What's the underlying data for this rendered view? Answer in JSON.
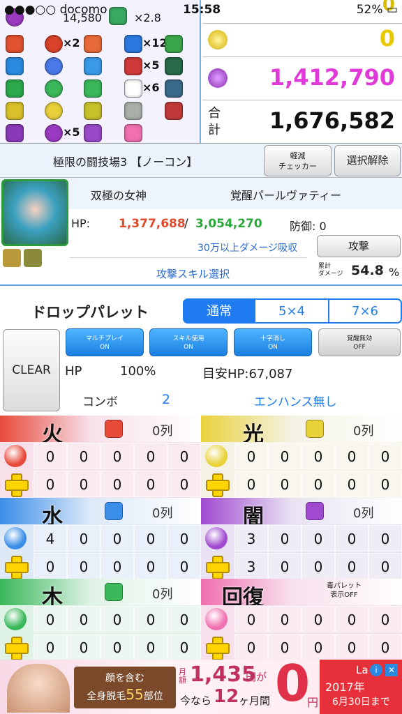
{
  "status_bar": {
    "carrier": "●●●○○ docomo",
    "time": "15:58",
    "battery": "52%"
  },
  "skill_panel": {
    "score": "14,580",
    "multiplier": "×2.8",
    "counts": [
      "×2",
      "×12",
      "×5",
      "×6",
      "×5"
    ]
  },
  "damage_panel": {
    "light_value": "0",
    "dark_value": "1,412,790",
    "total_label_1": "合",
    "total_label_2": "計",
    "total_value": "1,676,582",
    "top_value": "0"
  },
  "quest": {
    "name": "極限の闘技場3 【ノーコン】",
    "reduce_btn_1": "軽減",
    "reduce_btn_2": "チェッカー",
    "deselect_btn": "選択解除"
  },
  "monster": {
    "name_left": "双極の女神",
    "name_right": "覚醒パールヴァティー",
    "hp_label": "HP:",
    "hp_current": "1,377,688",
    "hp_sep": "/",
    "hp_max": "3,054,270",
    "defense": "防御: 0",
    "absorb": "30万以上ダメージ吸収",
    "attack_btn": "攻撃",
    "skill_select": "攻撃スキル選択",
    "cumulative_1": "累計",
    "cumulative_2": "ダメージ",
    "cumulative_value": "54.8",
    "cumulative_unit": "%"
  },
  "palette": {
    "title": "ドロップパレット",
    "tabs": [
      "通常",
      "5×4",
      "7×6"
    ],
    "active_tab": "通常",
    "clear": "CLEAR",
    "toggles": [
      {
        "label": "マルチプレイ",
        "state": "ON"
      },
      {
        "label": "スキル使用",
        "state": "ON"
      },
      {
        "label": "十字消し",
        "state": "ON"
      },
      {
        "label": "覚醒無効",
        "state": "OFF"
      }
    ],
    "hp_label": "HP",
    "hp_value": "100%",
    "target_hp": "目安HP:67,087",
    "combo_label": "コンボ",
    "combo_value": "2",
    "enhance": "エンハンス無し"
  },
  "attributes": [
    {
      "name": "火",
      "rows": "0列",
      "base": [
        "0",
        "0",
        "0",
        "0",
        "0"
      ],
      "plus": [
        "0",
        "0",
        "0",
        "0",
        "0"
      ],
      "color": "#e84a3a"
    },
    {
      "name": "光",
      "rows": "0列",
      "base": [
        "0",
        "0",
        "0",
        "0",
        "0"
      ],
      "plus": [
        "0",
        "0",
        "0",
        "0",
        "0"
      ],
      "color": "#e8d23a"
    },
    {
      "name": "水",
      "rows": "0列",
      "base": [
        "4",
        "0",
        "0",
        "0",
        "0"
      ],
      "plus": [
        "0",
        "0",
        "0",
        "0",
        "0"
      ],
      "color": "#3a8ee8"
    },
    {
      "name": "闇",
      "rows": "0列",
      "base": [
        "3",
        "0",
        "0",
        "0",
        "0"
      ],
      "plus": [
        "3",
        "0",
        "0",
        "0",
        "0"
      ],
      "color": "#a04ad0"
    },
    {
      "name": "木",
      "rows": "0列",
      "base": [
        "0",
        "0",
        "0",
        "0",
        "0"
      ],
      "plus": [
        "0",
        "0",
        "0",
        "0",
        "0"
      ],
      "color": "#3ab85a"
    },
    {
      "name": "回復",
      "poison_1": "毒パレット",
      "poison_2": "表示OFF",
      "base": [
        "0",
        "0",
        "0",
        "0",
        "0"
      ],
      "plus": [
        "0",
        "0",
        "0",
        "0",
        "0"
      ],
      "color": "#f070b0"
    }
  ],
  "ad": {
    "text1": "顔を含む",
    "text2": "全身脱毛",
    "text3": "55",
    "text4": "部位",
    "price_label": "月額",
    "price": "1,435",
    "price_unit": "円が",
    "promo": "今なら",
    "months": "12",
    "months_unit": "ヶ月間",
    "zero": "0",
    "yen": "円",
    "year": "2017年",
    "until": "6月30日まで",
    "brand": "La"
  }
}
